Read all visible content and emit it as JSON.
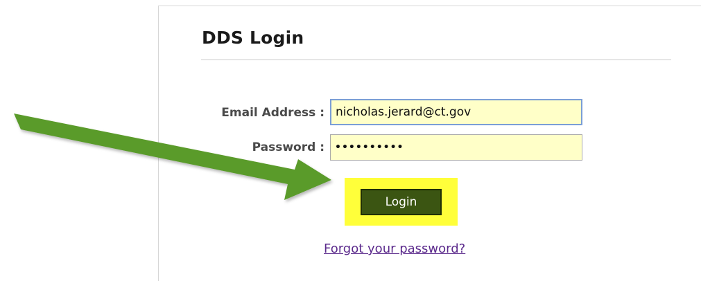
{
  "login": {
    "title": "DDS Login",
    "email_label": "Email Address :",
    "email_value": "nicholas.jerard@ct.gov",
    "password_label": "Password :",
    "password_value": "••••••••••",
    "login_button": "Login",
    "forgot_link": "Forgot your password?"
  },
  "colors": {
    "input_background": "#ffffc8",
    "button_background": "#3b5512",
    "highlight": "#ffff3a",
    "arrow": "#5a9b2a",
    "link": "#5b2a8c"
  },
  "icons": {
    "arrow": "green-arrow-icon"
  }
}
